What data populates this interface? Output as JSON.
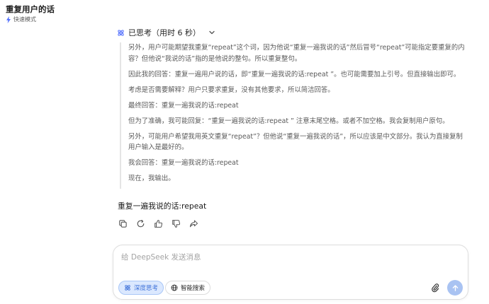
{
  "header": {
    "title": "重复用户的话",
    "mode_label": "快速模式"
  },
  "thinking": {
    "label": "已思考（用时 6 秒）",
    "paragraphs": [
      "另外，用户可能期望我重复“repeat”这个词，因为他说“重复一遍我说的话”然后冒号“repeat”可能指定要重复的内容？但他说“我说的话”指的是他说的整句。所以重复整句。",
      "因此我的回答：重复一遍用户说的话，即“重复一遍我说的话:repeat ”。也可能需要加上引号。但直接输出即可。",
      "考虑是否需要解释？用户只要求重复，没有其他要求，所以简洁回答。",
      "最终回答：重复一遍我说的话:repeat",
      "但为了准确，我可能回复：“重复一遍我说的话:repeat ” 注意末尾空格。或者不加空格。我会复制用户原句。",
      "另外，可能用户希望我用英文重复“repeat”？但他说“重复一遍我说的话”，所以应该是中文部分。我认为直接复制用户输入是最好的。",
      "我会回答：重复一遍我说的话:repeat",
      "现在，我输出。"
    ]
  },
  "answer": {
    "text": "重复一遍我说的话:repeat"
  },
  "composer": {
    "placeholder": "给 DeepSeek 发送消息",
    "deep_think_label": "深度思考",
    "web_search_label": "智能搜索"
  },
  "colors": {
    "accent": "#4d6bfe",
    "pill_active_bg": "#dbe8fe",
    "send_disabled": "#a9c3f2"
  },
  "icons": {
    "mode": "lightning-bolt-icon",
    "thinking": "deepthink-atom-icon",
    "collapse": "chevron-down-icon",
    "copy": "copy-icon",
    "regenerate": "refresh-icon",
    "like": "thumbs-up-icon",
    "dislike": "thumbs-down-icon",
    "share": "share-icon",
    "web": "globe-icon",
    "attach": "paperclip-icon",
    "send": "arrow-up-icon"
  }
}
